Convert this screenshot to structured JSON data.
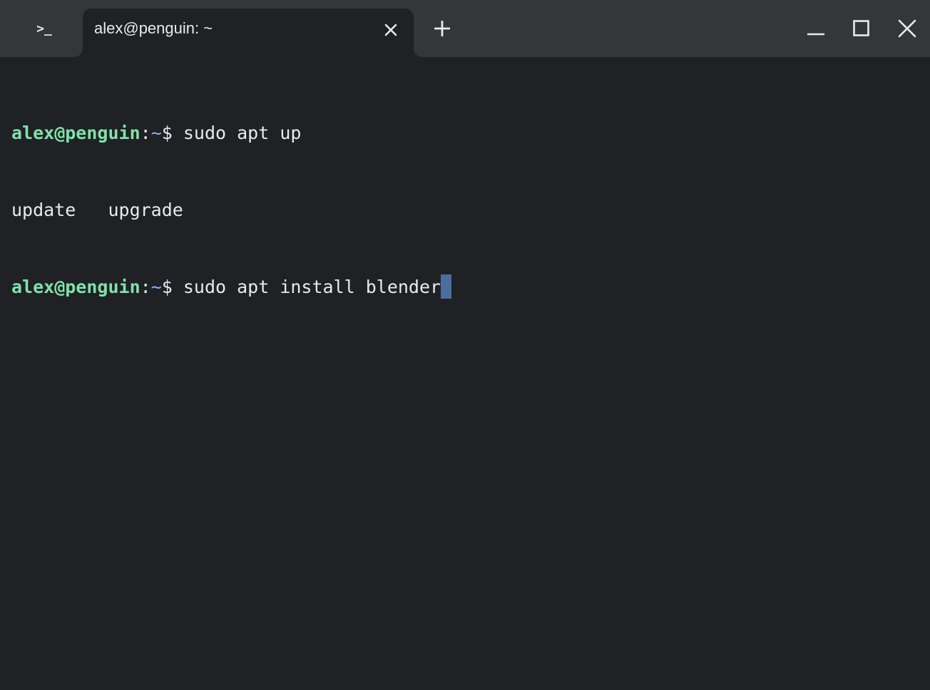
{
  "colors": {
    "titlebar_bg": "#35363a",
    "terminal_bg": "#202124",
    "text": "#e8eaed",
    "prompt_user_host": "#7fe2a9",
    "prompt_path": "#8ab4f8",
    "cursor": "#4c6e9e"
  },
  "titlebar": {
    "app_icon": "terminal-prompt-icon",
    "app_icon_glyph": ">_",
    "tab": {
      "title": "alex@penguin: ~",
      "close_icon": "close-icon"
    },
    "new_tab_icon": "plus-icon",
    "window_controls": [
      "minimize-icon",
      "maximize-icon",
      "close-icon"
    ]
  },
  "terminal": {
    "lines": [
      {
        "type": "prompt",
        "user_host": "alex@penguin",
        "separator": ":",
        "path": "~",
        "symbol": "$ ",
        "command": "sudo apt up"
      },
      {
        "type": "output",
        "text": "update   upgrade"
      },
      {
        "type": "prompt",
        "user_host": "alex@penguin",
        "separator": ":",
        "path": "~",
        "symbol": "$ ",
        "command": "sudo apt install blender"
      }
    ]
  }
}
